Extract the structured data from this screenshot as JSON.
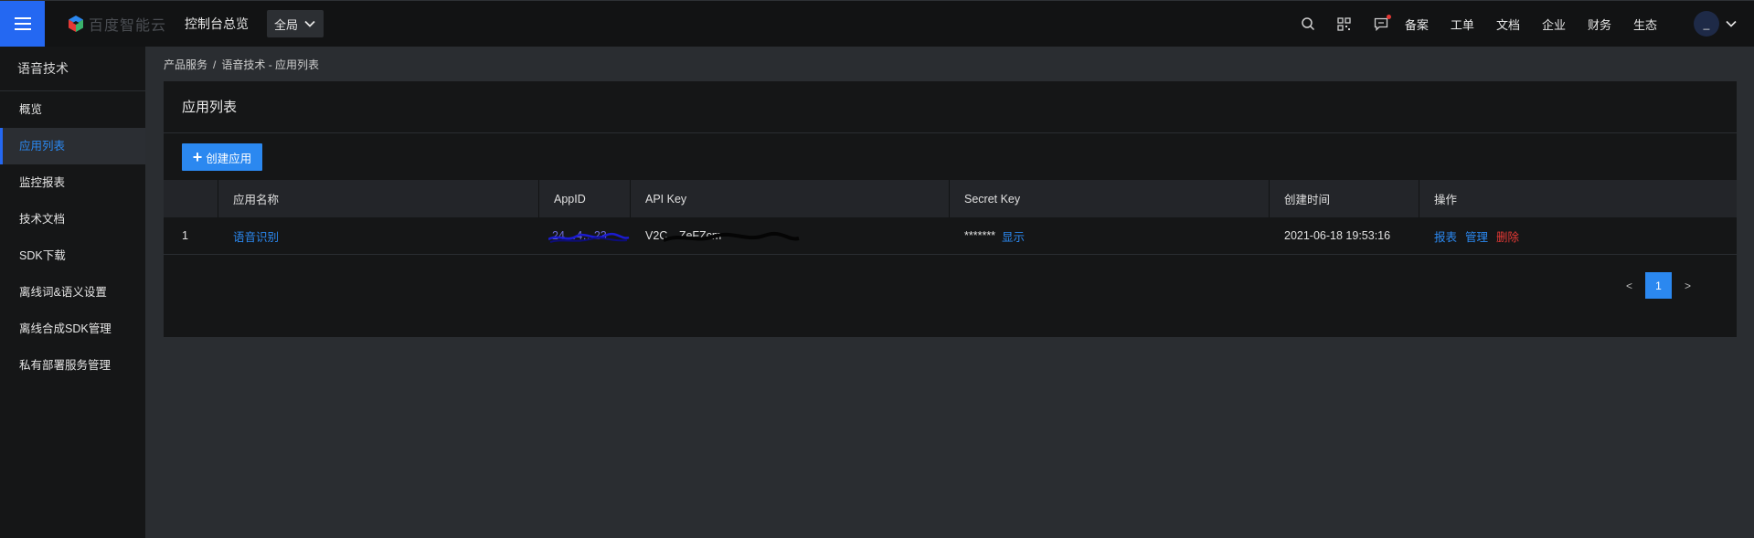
{
  "topbar": {
    "brand": "百度智能云",
    "console_overview": "控制台总览",
    "scope": "全局",
    "links": [
      "备案",
      "工单",
      "文档",
      "企业",
      "财务",
      "生态"
    ],
    "avatar_text": "_"
  },
  "sidebar": {
    "title": "语音技术",
    "items": [
      {
        "label": "概览"
      },
      {
        "label": "应用列表"
      },
      {
        "label": "监控报表"
      },
      {
        "label": "技术文档"
      },
      {
        "label": "SDK下载"
      },
      {
        "label": "离线词&语义设置"
      },
      {
        "label": "离线合成SDK管理"
      },
      {
        "label": "私有部署服务管理"
      }
    ]
  },
  "breadcrumb": {
    "root": "产品服务",
    "separator": "/",
    "current": "语音技术 - 应用列表"
  },
  "main": {
    "title": "应用列表",
    "create_button": "创建应用",
    "table": {
      "headers": [
        "",
        "应用名称",
        "AppID",
        "API Key",
        "Secret Key",
        "创建时间",
        "操作"
      ],
      "rows": [
        {
          "index": "1",
          "name": "语音识别",
          "appid": "24…4…23",
          "api_key": "V2C…ZeFZcm",
          "secret_masked": "*******",
          "secret_show": "显示",
          "created": "2021-06-18 19:53:16",
          "op_report": "报表",
          "op_manage": "管理",
          "op_delete": "删除"
        }
      ]
    },
    "pagination": {
      "prev": "<",
      "current": "1",
      "next": ">"
    }
  },
  "colors": {
    "accent": "#2468f2",
    "link": "#2b88f0",
    "danger": "#e53935"
  }
}
